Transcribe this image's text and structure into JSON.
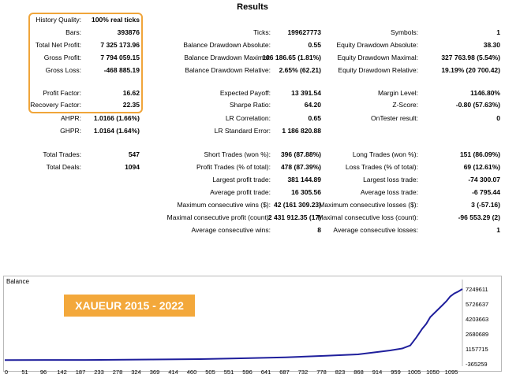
{
  "title": "Results",
  "rows": [
    {
      "y": 25,
      "cells": [
        {
          "label": "History Quality:",
          "value": "100% real ticks"
        }
      ]
    },
    {
      "y": 41,
      "cells": [
        {
          "label": "Bars:",
          "value": "393876"
        },
        {
          "label": "Ticks:",
          "value": "199627773"
        },
        {
          "label": "Symbols:",
          "value": "1"
        }
      ]
    },
    {
      "y": 57,
      "cells": [
        {
          "label": "Total Net Profit:",
          "value": "7 325 173.96"
        },
        {
          "label": "Balance Drawdown Absolute:",
          "value": "0.55"
        },
        {
          "label": "Equity Drawdown Absolute:",
          "value": "38.30"
        }
      ]
    },
    {
      "y": 73,
      "cells": [
        {
          "label": "Gross Profit:",
          "value": "7 794 059.15"
        },
        {
          "label": "Balance Drawdown Maximal:",
          "value": "106 186.65 (1.81%)"
        },
        {
          "label": "Equity Drawdown Maximal:",
          "value": "327 763.98 (5.54%)"
        }
      ]
    },
    {
      "y": 89,
      "cells": [
        {
          "label": "Gross Loss:",
          "value": "-468 885.19"
        },
        {
          "label": "Balance Drawdown Relative:",
          "value": "2.65% (62.21)"
        },
        {
          "label": "Equity Drawdown Relative:",
          "value": "19.19% (20 700.42)"
        }
      ]
    },
    {
      "y": 118,
      "cells": [
        {
          "label": "Profit Factor:",
          "value": "16.62"
        },
        {
          "label": "Expected Payoff:",
          "value": "13 391.54"
        },
        {
          "label": "Margin Level:",
          "value": "1146.80%"
        }
      ]
    },
    {
      "y": 133,
      "cells": [
        {
          "label": "Recovery Factor:",
          "value": "22.35"
        },
        {
          "label": "Sharpe Ratio:",
          "value": "64.20"
        },
        {
          "label": "Z-Score:",
          "value": "-0.80 (57.63%)"
        }
      ]
    },
    {
      "y": 150,
      "cells": [
        {
          "label": "AHPR:",
          "value": "1.0166 (1.66%)"
        },
        {
          "label": "LR Correlation:",
          "value": "0.65"
        },
        {
          "label": "OnTester result:",
          "value": "0"
        }
      ]
    },
    {
      "y": 166,
      "cells": [
        {
          "label": "GHPR:",
          "value": "1.0164 (1.64%)"
        },
        {
          "label": "LR Standard Error:",
          "value": "1 186 820.88"
        }
      ]
    },
    {
      "y": 196,
      "cells": [
        {
          "label": "Total Trades:",
          "value": "547"
        },
        {
          "label": "Short Trades (won %):",
          "value": "396 (87.88%)"
        },
        {
          "label": "Long Trades (won %):",
          "value": "151 (86.09%)"
        }
      ]
    },
    {
      "y": 212,
      "cells": [
        {
          "label": "Total Deals:",
          "value": "1094"
        },
        {
          "label": "Profit Trades (% of total):",
          "value": "478 (87.39%)"
        },
        {
          "label": "Loss Trades (% of total):",
          "value": "69 (12.61%)"
        }
      ]
    },
    {
      "y": 228,
      "cells": [
        {
          "label": "Largest profit trade:",
          "value": "381 144.89"
        },
        {
          "label": "Largest loss trade:",
          "value": "-74 300.07"
        }
      ]
    },
    {
      "y": 244,
      "cells": [
        {
          "label": "Average profit trade:",
          "value": "16 305.56"
        },
        {
          "label": "Average loss trade:",
          "value": "-6 795.44"
        }
      ]
    },
    {
      "y": 260,
      "cells": [
        {
          "label": "Maximum consecutive wins ($):",
          "value": "42 (161 309.23)"
        },
        {
          "label": "Maximum consecutive losses ($):",
          "value": "3 (-57.16)"
        }
      ]
    },
    {
      "y": 276,
      "cells": [
        {
          "label": "Maximal consecutive profit (count):",
          "value": "2 431 912.35 (17)"
        },
        {
          "label": "Maximal consecutive loss (count):",
          "value": "-96 553.29 (2)"
        }
      ]
    },
    {
      "y": 292,
      "cells": [
        {
          "label": "Average consecutive wins:",
          "value": "8"
        },
        {
          "label": "Average consecutive losses:",
          "value": "1"
        }
      ]
    }
  ],
  "chart_data": {
    "type": "line",
    "title": "Balance",
    "overlay_label": "XAUEUR 2015 - 2022",
    "x_ticks": [
      "0",
      "51",
      "96",
      "142",
      "187",
      "233",
      "278",
      "324",
      "369",
      "414",
      "460",
      "505",
      "551",
      "596",
      "641",
      "687",
      "732",
      "778",
      "823",
      "868",
      "914",
      "959",
      "1005",
      "1050",
      "1095"
    ],
    "y_ticks": [
      "7249611",
      "5726637",
      "4203663",
      "2680689",
      "1157715",
      "-365259"
    ],
    "ylim": [
      -365259,
      7249611
    ],
    "xlim": [
      0,
      1140
    ],
    "series_color": "#1f1f9c",
    "series": [
      {
        "x": [
          0,
          100,
          200,
          300,
          400,
          500,
          600,
          700,
          800,
          880,
          920,
          960,
          990,
          1010,
          1025,
          1040,
          1050,
          1060,
          1070,
          1080,
          1090,
          1100,
          1110,
          1120,
          1130,
          1140
        ],
        "y": [
          20000,
          25000,
          30000,
          50000,
          80000,
          120000,
          200000,
          300000,
          450000,
          600000,
          800000,
          1000000,
          1200000,
          1500000,
          2300000,
          3200000,
          3700000,
          4400000,
          4800000,
          5200000,
          5600000,
          6000000,
          6500000,
          6800000,
          7000000,
          7249611
        ]
      }
    ]
  }
}
